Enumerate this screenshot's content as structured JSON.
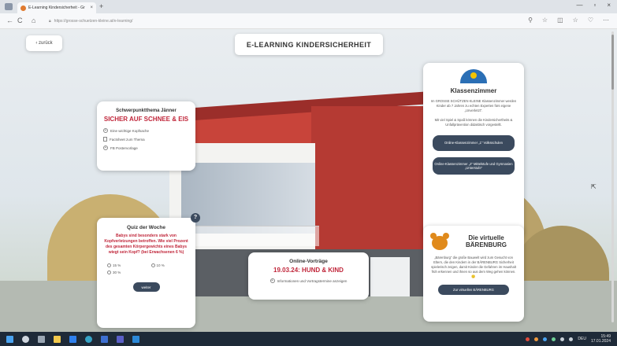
{
  "browser": {
    "tab_title": "E-Learning Kindersicherheit - Gr",
    "tab_close": "×",
    "new_tab": "+",
    "url": "https://grosse-schuetzen-kleine.at/e-learning/",
    "window_controls": [
      "—",
      "▫",
      "×"
    ],
    "nav": {
      "back": "←",
      "forward": "→",
      "reload": "C",
      "home": "⌂"
    },
    "tools": [
      "⚲",
      "☆",
      "◫",
      "☆",
      "♡",
      "⋯"
    ]
  },
  "page": {
    "back_label": "‹ zurück",
    "title": "E-LEARNING KINDERSICHERHEIT"
  },
  "focus": {
    "heading": "Schwerpunktthema Jänner",
    "headline": "SICHER AUF SCHNEE & EIS",
    "links": [
      "Eine wichtige Kopfsache",
      "Factsheet zum Thema",
      "FB Postervorlage"
    ]
  },
  "classroom": {
    "heading": "Klassenzimmer",
    "para1": "Im GROSSE SCHÜTZEN KLEINE Klassenzimmer werden Kinder ab 7 Jahren zu echten Experten fürs eigene „Unverletzt“.",
    "para2": "Mit viel Spiel & Spaß können die Kindersichertheits & Unfallprävention didaktisch vorgestellt.",
    "btn1": "Online-Klassenzimmer „1“ Volksschulen",
    "btn2": "Online-Klassenzimmer „2“ Mittelstufe und Gymnasien „Unterstufe“"
  },
  "quiz": {
    "badge": "?",
    "heading": "Quiz der Woche",
    "question": "Babys sind besonders stark von Kopfverletzungen betroffen. Wie viel Prozent des gesamten Körpergewichts eines Babys wiegt sein Kopf? (bei Erwachsenen 6 %)",
    "options": [
      "15 %",
      "10 %",
      "30 %"
    ],
    "button": "weiter"
  },
  "talks": {
    "heading": "Online-Vorträge",
    "headline": "19.03.24: HUND & KIND",
    "link": "Informationen und Vortragstermine anzeigen"
  },
  "bear": {
    "title": "Die virtuelle BÄRENBURG",
    "para": "„Bärenburg“ die große Bauwelt wird zum Gesucht von Eltern, die den Kindern in der BÄRENBURG Sicherheit spielerisch zeigen, damit Kinder die Gefahren im Haushalt früh erkennen und ihnen so aus dem Weg gehen können. 🙂",
    "button": "Zur virtuellen BÄRENBURG"
  },
  "taskbar": {
    "apps": [
      "start",
      "search",
      "taskview",
      "explorer",
      "mail",
      "edge",
      "store",
      "teams",
      "office"
    ],
    "time": "15:49",
    "date": "17.01.2024",
    "lang": "DEU"
  },
  "colors": {
    "accent_red": "#c0263a",
    "button_navy": "#3b4a5e",
    "house_red": "#b53a33",
    "taskbar": "#1e2a38"
  }
}
